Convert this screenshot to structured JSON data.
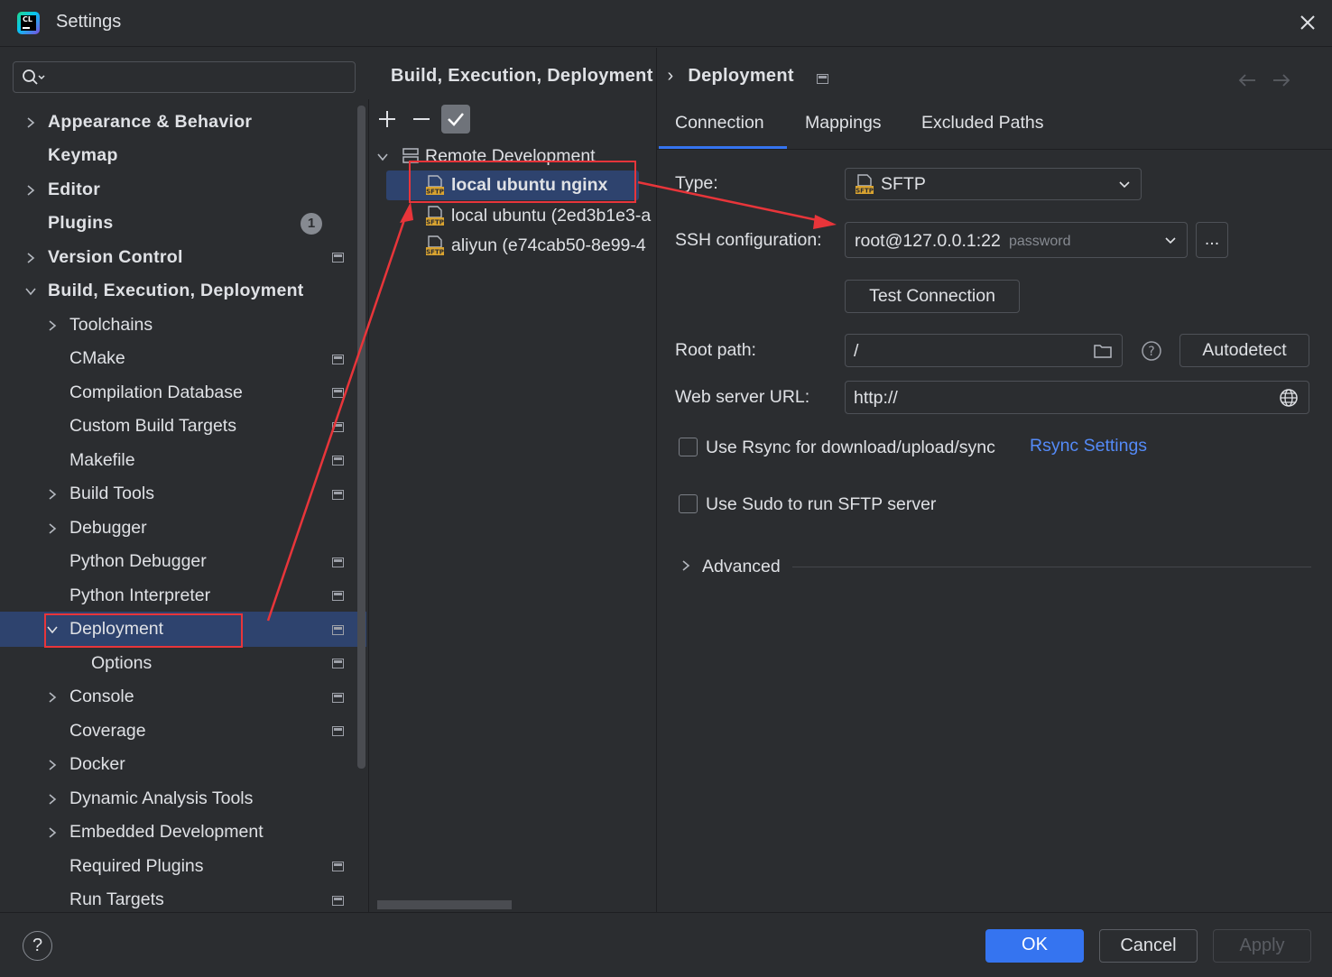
{
  "window": {
    "title": "Settings"
  },
  "sidebar": {
    "search_placeholder": "",
    "items": [
      {
        "label": "Appearance & Behavior"
      },
      {
        "label": "Keymap"
      },
      {
        "label": "Editor"
      },
      {
        "label": "Plugins",
        "badge": "1"
      },
      {
        "label": "Version Control"
      },
      {
        "label": "Build, Execution, Deployment"
      },
      {
        "label": "Toolchains"
      },
      {
        "label": "CMake"
      },
      {
        "label": "Compilation Database"
      },
      {
        "label": "Custom Build Targets"
      },
      {
        "label": "Makefile"
      },
      {
        "label": "Build Tools"
      },
      {
        "label": "Debugger"
      },
      {
        "label": "Python Debugger"
      },
      {
        "label": "Python Interpreter"
      },
      {
        "label": "Deployment"
      },
      {
        "label": "Options"
      },
      {
        "label": "Console"
      },
      {
        "label": "Coverage"
      },
      {
        "label": "Docker"
      },
      {
        "label": "Dynamic Analysis Tools"
      },
      {
        "label": "Embedded Development"
      },
      {
        "label": "Required Plugins"
      },
      {
        "label": "Run Targets"
      }
    ]
  },
  "breadcrumb": {
    "parent": "Build, Execution, Deployment",
    "separator": "›",
    "current": "Deployment"
  },
  "servers": {
    "group": "Remote Development",
    "items": [
      {
        "label": "local ubuntu nginx",
        "icon": "sftp-icon"
      },
      {
        "label": "local ubuntu (2ed3b1e3-a",
        "icon": "sftp-icon"
      },
      {
        "label": "aliyun (e74cab50-8e99-4",
        "icon": "sftp-icon"
      }
    ],
    "sftp_icon_text": "SFTP"
  },
  "tabs": [
    {
      "label": "Connection"
    },
    {
      "label": "Mappings"
    },
    {
      "label": "Excluded Paths"
    }
  ],
  "connection": {
    "type_label": "Type:",
    "type_value": "SFTP",
    "ssh_label": "SSH configuration:",
    "ssh_value": "root@127.0.0.1:22",
    "ssh_hint": "password",
    "ssh_more": "...",
    "test_button": "Test Connection",
    "root_label": "Root path:",
    "root_value": "/",
    "root_help": "?",
    "autodetect_button": "Autodetect",
    "web_label": "Web server URL:",
    "web_value": "http://",
    "rsync_label": "Use Rsync for download/upload/sync",
    "rsync_link": "Rsync Settings",
    "sudo_label": "Use Sudo to run SFTP server",
    "advanced_label": "Advanced"
  },
  "footer": {
    "help": "?",
    "ok": "OK",
    "cancel": "Cancel",
    "apply": "Apply"
  },
  "colors": {
    "accent": "#3574f0",
    "annotation": "#e8353a",
    "selection": "#2e436e",
    "link": "#548af7"
  }
}
